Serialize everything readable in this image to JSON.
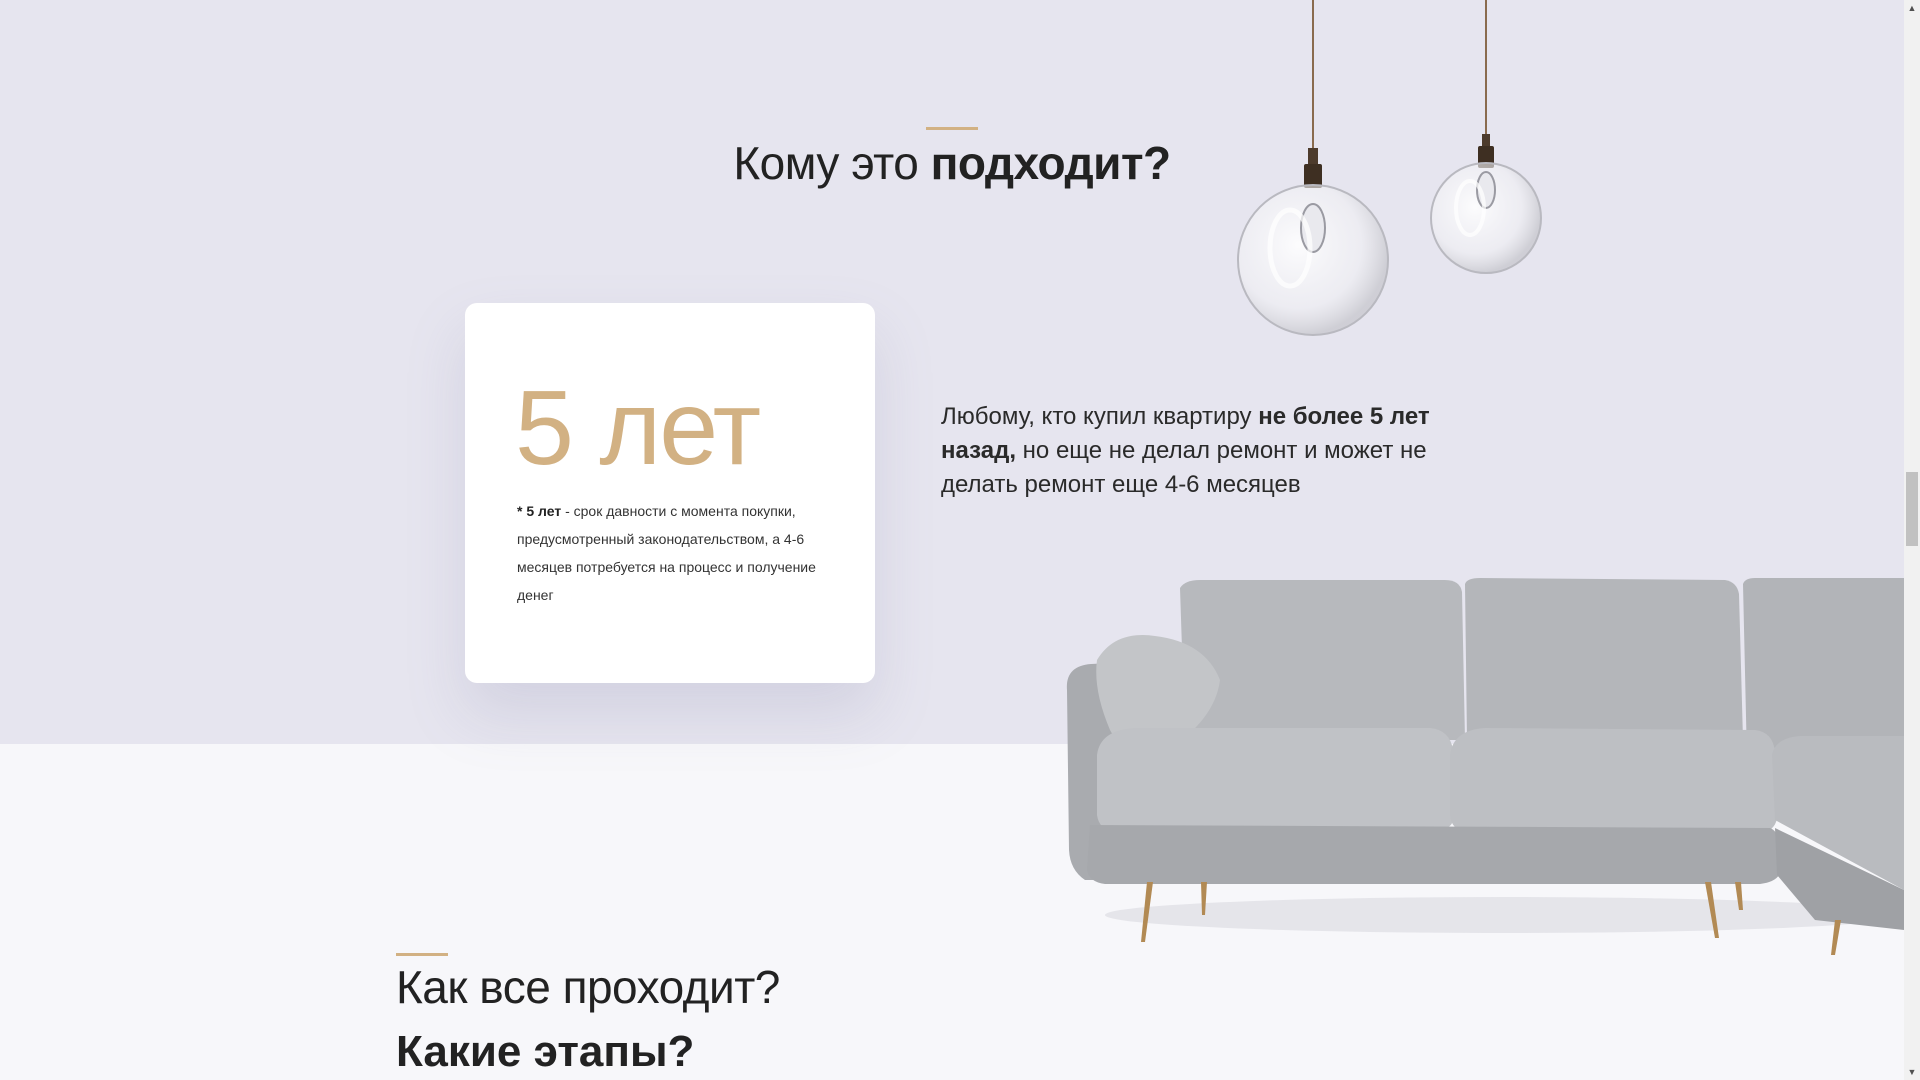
{
  "who": {
    "title_regular": "Кому это ",
    "title_bold": "подходит?"
  },
  "card": {
    "big_value": "5 лет",
    "note_bold": "* 5 лет",
    "note_text": " - срок давности с момента покупки, предусмотренный законодательством, а 4-6 месяцев потребуется на процесс и получение денег"
  },
  "description": {
    "part1": "Любому, кто купил квартиру ",
    "bold": "не более 5 лет назад,",
    "part2": " но еще не делал ремонт и может не делать ремонт еще 4-6 месяцев"
  },
  "how": {
    "title": "Как все проходит?",
    "subtitle": "Какие этапы?"
  },
  "scrollbar": {
    "up_arrow": "▲",
    "down_arrow": "▼"
  },
  "colors": {
    "accent": "#d2b183",
    "section_top_bg": "#e6e5ef",
    "section_bottom_bg": "#f7f7fa"
  },
  "icons": [
    "pendant-lamp-icon",
    "sofa-image"
  ]
}
